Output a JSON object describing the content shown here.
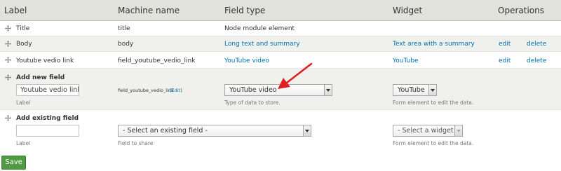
{
  "header": {
    "label": "Label",
    "machine_name": "Machine name",
    "field_type": "Field type",
    "widget": "Widget",
    "operations": "Operations"
  },
  "rows": [
    {
      "label": "Title",
      "machine_name": "title",
      "field_type": "Node module element",
      "widget": "",
      "edit": "",
      "delete": ""
    },
    {
      "label": "Body",
      "machine_name": "body",
      "field_type": "Long text and summary",
      "widget": "Text area with a summary",
      "edit": "edit",
      "delete": "delete"
    },
    {
      "label": "Youtube vedio link",
      "machine_name": "field_youtube_vedio_link",
      "field_type": "YouTube video",
      "widget": "YouTube",
      "edit": "edit",
      "delete": "delete"
    }
  ],
  "add_new_field": {
    "heading": "Add new field",
    "label_value": "Youtube vedio link",
    "label_caption": "Label",
    "machine_name": "field_youtube_vedio_link",
    "edit_link": "[Edit]",
    "type_selected": "YouTube video",
    "type_caption": "Type of data to store.",
    "widget_selected": "YouTube",
    "widget_caption": "Form element to edit the data."
  },
  "add_existing_field": {
    "heading": "Add existing field",
    "label_value": "",
    "label_caption": "Label",
    "field_selected": "- Select an existing field -",
    "field_caption": "Field to share",
    "widget_selected": "- Select a widget -",
    "widget_caption": "Form element to edit the data."
  },
  "save_label": "Save",
  "icons": {
    "drag_handle": "move-cross-icon",
    "annotation": "red-arrow-annotation"
  },
  "colors": {
    "link": "#0071b3",
    "header_bg": "#e1e2dc",
    "save_bg": "#4f9a42",
    "annotation": "#e02020"
  }
}
